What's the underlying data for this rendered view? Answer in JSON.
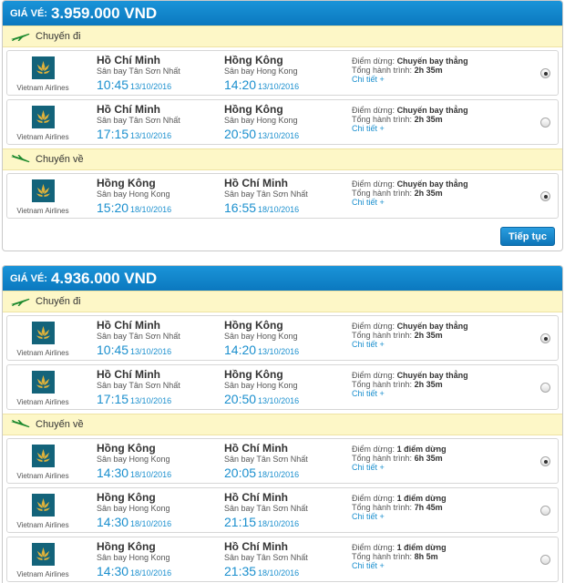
{
  "packages": [
    {
      "price_label": "GIÁ VÉ:",
      "price_value": "3.959.000 VND",
      "outbound_label": "Chuyến đi",
      "return_label": "Chuyến về",
      "continue_label": "Tiếp tục",
      "outbound": [
        {
          "airline": "Vietnam Airlines",
          "dep_city": "Hồ Chí Minh",
          "dep_airport": "Sân bay Tân Sơn Nhất",
          "dep_time": "10:45",
          "dep_date": "13/10/2016",
          "arr_city": "Hồng Kông",
          "arr_airport": "Sân bay Hong Kong",
          "arr_time": "14:20",
          "arr_date": "13/10/2016",
          "stops_label": "Điểm dừng:",
          "stops": "Chuyến bay thẳng",
          "duration_label": "Tổng hành trình:",
          "duration": "2h 35m",
          "detail": "Chi tiết +",
          "selected": true
        },
        {
          "airline": "Vietnam Airlines",
          "dep_city": "Hồ Chí Minh",
          "dep_airport": "Sân bay Tân Sơn Nhất",
          "dep_time": "17:15",
          "dep_date": "13/10/2016",
          "arr_city": "Hồng Kông",
          "arr_airport": "Sân bay Hong Kong",
          "arr_time": "20:50",
          "arr_date": "13/10/2016",
          "stops_label": "Điểm dừng:",
          "stops": "Chuyến bay thẳng",
          "duration_label": "Tổng hành trình:",
          "duration": "2h 35m",
          "detail": "Chi tiết +",
          "selected": false
        }
      ],
      "return": [
        {
          "airline": "Vietnam Airlines",
          "dep_city": "Hồng Kông",
          "dep_airport": "Sân bay Hong Kong",
          "dep_time": "15:20",
          "dep_date": "18/10/2016",
          "arr_city": "Hồ Chí Minh",
          "arr_airport": "Sân bay Tân Sơn Nhất",
          "arr_time": "16:55",
          "arr_date": "18/10/2016",
          "stops_label": "Điểm dừng:",
          "stops": "Chuyến bay thẳng",
          "duration_label": "Tổng hành trình:",
          "duration": "2h 35m",
          "detail": "Chi tiết +",
          "selected": true
        }
      ]
    },
    {
      "price_label": "GIÁ VÉ:",
      "price_value": "4.936.000 VND",
      "outbound_label": "Chuyến đi",
      "return_label": "Chuyến về",
      "outbound": [
        {
          "airline": "Vietnam Airlines",
          "dep_city": "Hồ Chí Minh",
          "dep_airport": "Sân bay Tân Sơn Nhất",
          "dep_time": "10:45",
          "dep_date": "13/10/2016",
          "arr_city": "Hồng Kông",
          "arr_airport": "Sân bay Hong Kong",
          "arr_time": "14:20",
          "arr_date": "13/10/2016",
          "stops_label": "Điểm dừng:",
          "stops": "Chuyến bay thẳng",
          "duration_label": "Tổng hành trình:",
          "duration": "2h 35m",
          "detail": "Chi tiết +",
          "selected": true
        },
        {
          "airline": "Vietnam Airlines",
          "dep_city": "Hồ Chí Minh",
          "dep_airport": "Sân bay Tân Sơn Nhất",
          "dep_time": "17:15",
          "dep_date": "13/10/2016",
          "arr_city": "Hồng Kông",
          "arr_airport": "Sân bay Hong Kong",
          "arr_time": "20:50",
          "arr_date": "13/10/2016",
          "stops_label": "Điểm dừng:",
          "stops": "Chuyến bay thẳng",
          "duration_label": "Tổng hành trình:",
          "duration": "2h 35m",
          "detail": "Chi tiết +",
          "selected": false
        }
      ],
      "return": [
        {
          "airline": "Vietnam Airlines",
          "dep_city": "Hồng Kông",
          "dep_airport": "Sân bay Hong Kong",
          "dep_time": "14:30",
          "dep_date": "18/10/2016",
          "arr_city": "Hồ Chí Minh",
          "arr_airport": "Sân bay Tân Sơn Nhất",
          "arr_time": "20:05",
          "arr_date": "18/10/2016",
          "stops_label": "Điểm dừng:",
          "stops": "1 điểm dừng",
          "duration_label": "Tổng hành trình:",
          "duration": "6h 35m",
          "detail": "Chi tiết +",
          "selected": true
        },
        {
          "airline": "Vietnam Airlines",
          "dep_city": "Hồng Kông",
          "dep_airport": "Sân bay Hong Kong",
          "dep_time": "14:30",
          "dep_date": "18/10/2016",
          "arr_city": "Hồ Chí Minh",
          "arr_airport": "Sân bay Tân Sơn Nhất",
          "arr_time": "21:15",
          "arr_date": "18/10/2016",
          "stops_label": "Điểm dừng:",
          "stops": "1 điểm dừng",
          "duration_label": "Tổng hành trình:",
          "duration": "7h 45m",
          "detail": "Chi tiết +",
          "selected": false
        },
        {
          "airline": "Vietnam Airlines",
          "dep_city": "Hồng Kông",
          "dep_airport": "Sân bay Hong Kong",
          "dep_time": "14:30",
          "dep_date": "18/10/2016",
          "arr_city": "Hồ Chí Minh",
          "arr_airport": "Sân bay Tân Sơn Nhất",
          "arr_time": "21:35",
          "arr_date": "18/10/2016",
          "stops_label": "Điểm dừng:",
          "stops": "1 điểm dừng",
          "duration_label": "Tổng hành trình:",
          "duration": "8h 5m",
          "detail": "Chi tiết +",
          "selected": false
        }
      ]
    }
  ],
  "colors": {
    "accent": "#1a8fce",
    "header_bar": "#0b78bf",
    "direction_bar": "#fdf7c7",
    "logo_bg": "#13637a",
    "logo_lotus": "#e0b23a"
  },
  "icons": {
    "outbound": "plane-departure-icon",
    "return": "plane-arrival-icon",
    "airline_logo": "lotus-logo-icon"
  }
}
